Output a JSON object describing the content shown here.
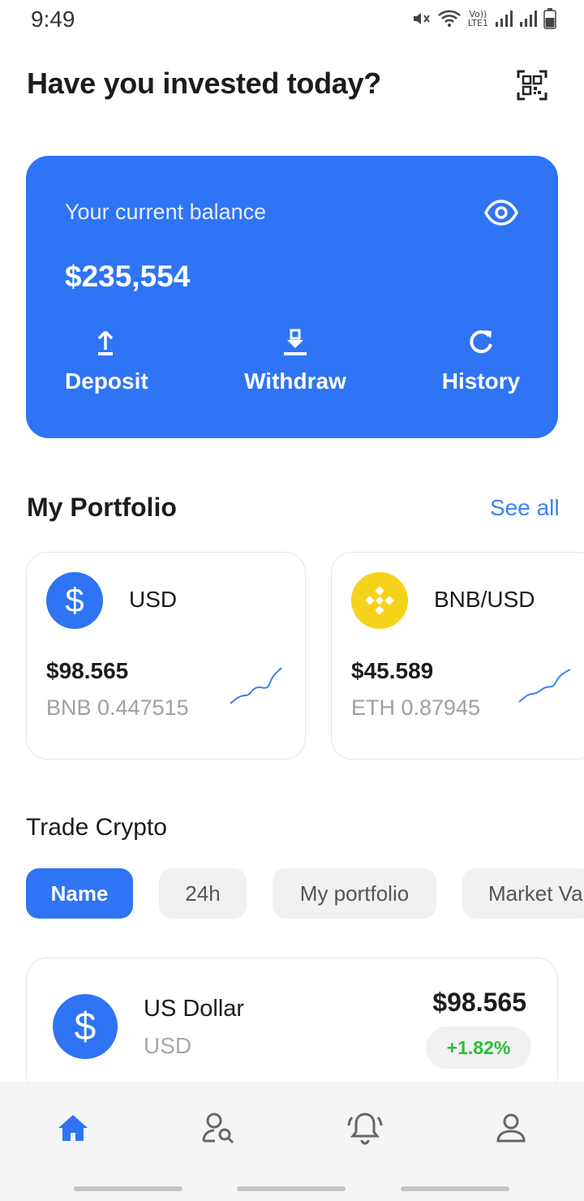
{
  "status_bar": {
    "time": "9:49",
    "lte_top": "Vo))",
    "lte_bottom": "LTE1",
    "icons": [
      "mute-icon",
      "wifi-icon",
      "signal-icon",
      "signal-icon",
      "battery-icon"
    ]
  },
  "header": {
    "title": "Have you invested today?",
    "qr_icon": "qr-code-icon"
  },
  "balance": {
    "label": "Your current balance",
    "value": "$235,554",
    "visibility_icon": "eye-icon",
    "actions": [
      {
        "label": "Deposit",
        "icon": "upload-arrow-icon"
      },
      {
        "label": "Withdraw",
        "icon": "download-arrow-icon"
      },
      {
        "label": "History",
        "icon": "refresh-icon"
      }
    ],
    "color": "#2f74f5"
  },
  "portfolio": {
    "title": "My Portfolio",
    "see_all": "See all",
    "cards": [
      {
        "pair": "USD",
        "price": "$98.565",
        "sub": "BNB 0.447515",
        "icon": "dollar-icon"
      },
      {
        "pair": "BNB/USD",
        "price": "$45.589",
        "sub": "ETH 0.87945",
        "icon": "binance-icon"
      }
    ]
  },
  "trade": {
    "title": "Trade Crypto",
    "filters": [
      "Name",
      "24h",
      "My portfolio",
      "Market Val"
    ],
    "active_filter": "Name",
    "items": [
      {
        "name": "US Dollar",
        "symbol": "USD",
        "price": "$98.565",
        "change": "+1.82%",
        "icon": "dollar-icon"
      }
    ],
    "positive_color": "#2bbf3a"
  },
  "bottom_nav": {
    "items": [
      "home-icon",
      "user-search-icon",
      "bell-icon",
      "profile-icon"
    ],
    "active": "home-icon"
  }
}
